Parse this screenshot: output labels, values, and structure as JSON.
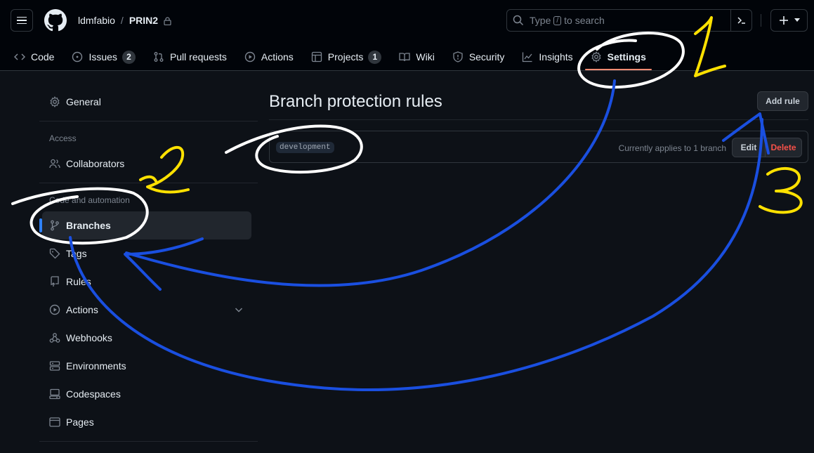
{
  "header": {
    "owner": "ldmfabio",
    "separator": "/",
    "repo": "PRIN2",
    "search": {
      "prefix": "Type",
      "key": "/",
      "suffix": "to search"
    }
  },
  "nav": {
    "items": [
      {
        "label": "Code",
        "icon": "code-icon"
      },
      {
        "label": "Issues",
        "icon": "issue-opened-icon",
        "count": "2"
      },
      {
        "label": "Pull requests",
        "icon": "git-pull-request-icon"
      },
      {
        "label": "Actions",
        "icon": "play-icon"
      },
      {
        "label": "Projects",
        "icon": "table-icon",
        "count": "1"
      },
      {
        "label": "Wiki",
        "icon": "book-icon"
      },
      {
        "label": "Security",
        "icon": "shield-icon"
      },
      {
        "label": "Insights",
        "icon": "graph-icon"
      },
      {
        "label": "Settings",
        "icon": "gear-icon",
        "selected": true
      }
    ]
  },
  "sidebar": {
    "general": "General",
    "access_heading": "Access",
    "collaborators": "Collaborators",
    "code_heading": "Code and automation",
    "items": [
      {
        "label": "Branches",
        "icon": "git-branch-icon",
        "selected": true
      },
      {
        "label": "Tags",
        "icon": "tag-icon"
      },
      {
        "label": "Rules",
        "icon": "repo-push-icon"
      },
      {
        "label": "Actions",
        "icon": "play-icon"
      },
      {
        "label": "Webhooks",
        "icon": "webhook-icon"
      },
      {
        "label": "Environments",
        "icon": "server-icon"
      },
      {
        "label": "Codespaces",
        "icon": "codespaces-icon"
      },
      {
        "label": "Pages",
        "icon": "browser-icon"
      }
    ]
  },
  "main": {
    "title": "Branch protection rules",
    "add_rule": "Add rule",
    "rules": [
      {
        "branch": "development",
        "applies": "Currently applies to 1 branch",
        "edit": "Edit",
        "delete": "Delete"
      }
    ]
  },
  "annotations": {
    "step1": "1",
    "step2": "2",
    "step3": "3",
    "number_color": "#ffe100",
    "arrow_color": "#1a4fe0",
    "circle_color": "#ffffff"
  },
  "colors": {
    "background": "#0d1117",
    "header_bg": "#010409",
    "selected_underline": "#fd8c73",
    "selected_marker": "#2f81f7",
    "danger": "#f85149"
  }
}
